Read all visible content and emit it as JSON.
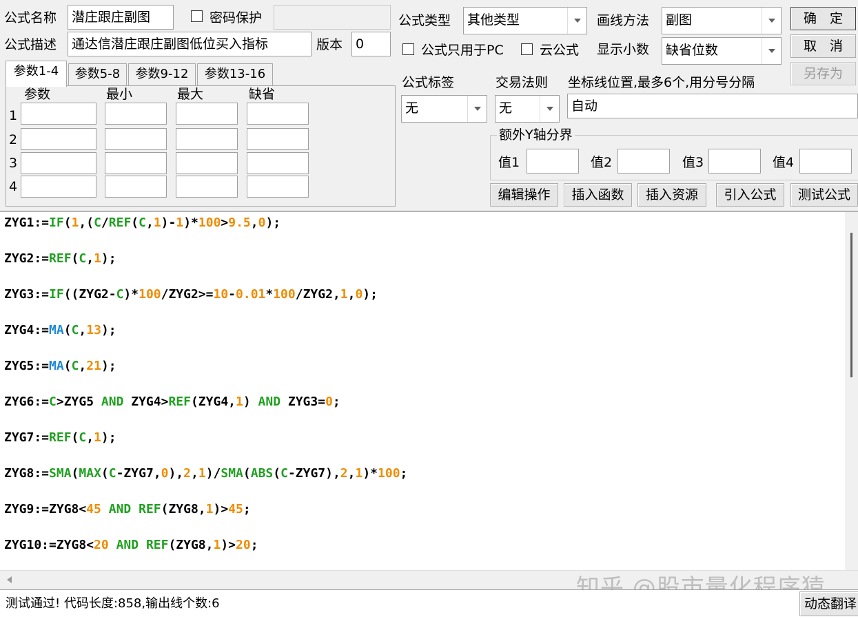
{
  "top": {
    "name_label": "公式名称",
    "name_value": "潜庄跟庄副图",
    "password_label": "密码保护",
    "password_checked": false,
    "desc_label": "公式描述",
    "desc_value": "通达信潜庄跟庄副图低位买入指标",
    "version_label": "版本",
    "version_value": "0",
    "type_label": "公式类型",
    "type_value": "其他类型",
    "pc_only_label": "公式只用于PC",
    "cloud_label": "云公式",
    "draw_label": "画线方法",
    "draw_value": "副图",
    "decimals_label": "显示小数",
    "decimals_value": "缺省位数",
    "ok": "确　定",
    "cancel": "取　消",
    "save_as": "另存为"
  },
  "params": {
    "tabs": [
      "参数1-4",
      "参数5-8",
      "参数9-12",
      "参数13-16"
    ],
    "headers": [
      "参数",
      "最小",
      "最大",
      "缺省"
    ],
    "rows": [
      "1",
      "2",
      "3",
      "4"
    ]
  },
  "mid": {
    "tag_label": "公式标签",
    "tag_value": "无",
    "trade_label": "交易法则",
    "trade_value": "无",
    "coord_label": "坐标线位置,最多6个,用分号分隔",
    "coord_value": "自动",
    "yaxis_group": "额外Y轴分界",
    "values": [
      "值1",
      "值2",
      "值3",
      "值4"
    ]
  },
  "actions": [
    "编辑操作",
    "插入函数",
    "插入资源",
    "引入公式",
    "测试公式"
  ],
  "code": [
    "ZYG1:=IF(1,(C/REF(C,1)-1)*100>9.5,0);",
    "ZYG2:=REF(C,1);",
    "ZYG3:=IF((ZYG2-C)*100/ZYG2>=10-0.01*100/ZYG2,1,0);",
    "ZYG4:=MA(C,13);",
    "ZYG5:=MA(C,21);",
    "ZYG6:=C>ZYG5 AND ZYG4>REF(ZYG4,1) AND ZYG3=0;",
    "ZYG7:=REF(C,1);",
    "ZYG8:=SMA(MAX(C-ZYG7,0),2,1)/SMA(ABS(C-ZYG7),2,1)*100;",
    "ZYG9:=ZYG8<45 AND REF(ZYG8,1)>45;",
    "ZYG10:=ZYG8<20 AND REF(ZYG8,1)>20;"
  ],
  "status": "测试通过! 代码长度:858,输出线个数:6",
  "translate_button": "动态翻译",
  "watermark": "知乎 @股市量化程序猿",
  "colors": {
    "function_green": "#21a021",
    "function_blue": "#1e8ad6",
    "number_orange": "#f08c00"
  }
}
